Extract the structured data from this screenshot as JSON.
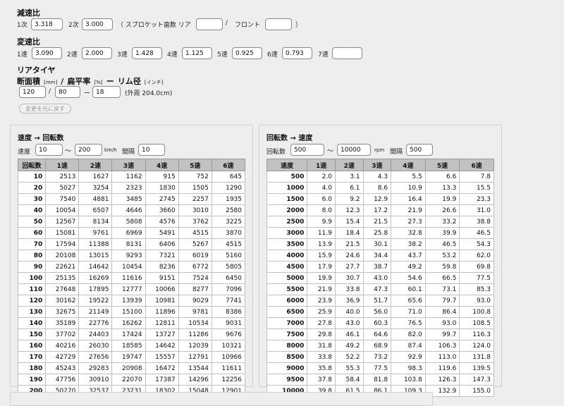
{
  "reduction": {
    "title": "減速比",
    "primary_label": "1次",
    "primary_value": "3.318",
    "secondary_label": "2次",
    "secondary_value": "3.000",
    "sprocket_label": "（ スプロケット歯数  リア",
    "rear_value": "",
    "slash": "/",
    "front_label": "フロント",
    "front_value": "",
    "close_paren": "）"
  },
  "gears": {
    "title": "変速比",
    "items": [
      {
        "label": "1速",
        "value": "3.090"
      },
      {
        "label": "2速",
        "value": "2.000"
      },
      {
        "label": "3速",
        "value": "1.428"
      },
      {
        "label": "4速",
        "value": "1.125"
      },
      {
        "label": "5速",
        "value": "0.925"
      },
      {
        "label": "6速",
        "value": "0.793"
      },
      {
        "label": "7速",
        "value": ""
      }
    ]
  },
  "tire": {
    "title": "リアタイヤ",
    "width_label": "断面積",
    "mm_unit": "[mm]",
    "slash1": "/",
    "aspect_label": "扁平率",
    "pct_unit": "[%]",
    "dash": "ー",
    "rim_label": "リム径",
    "inch_unit": "[インチ]",
    "width_value": "120",
    "aspect_value": "80",
    "rim_value": "18",
    "slash2": "/",
    "dash2": "ー",
    "circumference": "(外周 204.0cm)"
  },
  "reset_button": "変更を元に戻す",
  "speed_panel": {
    "title": "速度 → 回転数",
    "speed_label": "速度",
    "from": "10",
    "tilde": "〜",
    "to": "200",
    "unit": "km/h",
    "interval_label": "間隔",
    "interval": "10",
    "headers": [
      "回転数",
      "1速",
      "2速",
      "3速",
      "4速",
      "5速",
      "6速"
    ],
    "rows": [
      [
        "10",
        "2513",
        "1627",
        "1162",
        "915",
        "752",
        "645"
      ],
      [
        "20",
        "5027",
        "3254",
        "2323",
        "1830",
        "1505",
        "1290"
      ],
      [
        "30",
        "7540",
        "4881",
        "3485",
        "2745",
        "2257",
        "1935"
      ],
      [
        "40",
        "10054",
        "6507",
        "4646",
        "3660",
        "3010",
        "2580"
      ],
      [
        "50",
        "12567",
        "8134",
        "5808",
        "4576",
        "3762",
        "3225"
      ],
      [
        "60",
        "15081",
        "9761",
        "6969",
        "5491",
        "4515",
        "3870"
      ],
      [
        "70",
        "17594",
        "11388",
        "8131",
        "6406",
        "5267",
        "4515"
      ],
      [
        "80",
        "20108",
        "13015",
        "9293",
        "7321",
        "6019",
        "5160"
      ],
      [
        "90",
        "22621",
        "14642",
        "10454",
        "8236",
        "6772",
        "5805"
      ],
      [
        "100",
        "25135",
        "16269",
        "11616",
        "9151",
        "7524",
        "6450"
      ],
      [
        "110",
        "27648",
        "17895",
        "12777",
        "10066",
        "8277",
        "7096"
      ],
      [
        "120",
        "30162",
        "19522",
        "13939",
        "10981",
        "9029",
        "7741"
      ],
      [
        "130",
        "32675",
        "21149",
        "15100",
        "11896",
        "9781",
        "8386"
      ],
      [
        "140",
        "35189",
        "22776",
        "16262",
        "12811",
        "10534",
        "9031"
      ],
      [
        "150",
        "37702",
        "24403",
        "17424",
        "13727",
        "11286",
        "9676"
      ],
      [
        "160",
        "40216",
        "26030",
        "18585",
        "14642",
        "12039",
        "10321"
      ],
      [
        "170",
        "42729",
        "27656",
        "19747",
        "15557",
        "12791",
        "10966"
      ],
      [
        "180",
        "45243",
        "29283",
        "20908",
        "16472",
        "13544",
        "11611"
      ],
      [
        "190",
        "47756",
        "30910",
        "22070",
        "17387",
        "14296",
        "12256"
      ],
      [
        "200",
        "50270",
        "32537",
        "23231",
        "18302",
        "15048",
        "12901"
      ]
    ]
  },
  "rpm_panel": {
    "title": "回転数 → 速度",
    "rpm_label": "回転数",
    "from": "500",
    "tilde": "〜",
    "to": "10000",
    "unit": "rpm",
    "interval_label": "間隔",
    "interval": "500",
    "headers": [
      "速度",
      "1速",
      "2速",
      "3速",
      "4速",
      "5速",
      "6速"
    ],
    "rows": [
      [
        "500",
        "2.0",
        "3.1",
        "4.3",
        "5.5",
        "6.6",
        "7.8"
      ],
      [
        "1000",
        "4.0",
        "6.1",
        "8.6",
        "10.9",
        "13.3",
        "15.5"
      ],
      [
        "1500",
        "6.0",
        "9.2",
        "12.9",
        "16.4",
        "19.9",
        "23.3"
      ],
      [
        "2000",
        "8.0",
        "12.3",
        "17.2",
        "21.9",
        "26.6",
        "31.0"
      ],
      [
        "2500",
        "9.9",
        "15.4",
        "21.5",
        "27.3",
        "33.2",
        "38.8"
      ],
      [
        "3000",
        "11.9",
        "18.4",
        "25.8",
        "32.8",
        "39.9",
        "46.5"
      ],
      [
        "3500",
        "13.9",
        "21.5",
        "30.1",
        "38.2",
        "46.5",
        "54.3"
      ],
      [
        "4000",
        "15.9",
        "24.6",
        "34.4",
        "43.7",
        "53.2",
        "62.0"
      ],
      [
        "4500",
        "17.9",
        "27.7",
        "38.7",
        "49.2",
        "59.8",
        "69.8"
      ],
      [
        "5000",
        "19.9",
        "30.7",
        "43.0",
        "54.6",
        "66.5",
        "77.5"
      ],
      [
        "5500",
        "21.9",
        "33.8",
        "47.3",
        "60.1",
        "73.1",
        "85.3"
      ],
      [
        "6000",
        "23.9",
        "36.9",
        "51.7",
        "65.6",
        "79.7",
        "93.0"
      ],
      [
        "6500",
        "25.9",
        "40.0",
        "56.0",
        "71.0",
        "86.4",
        "100.8"
      ],
      [
        "7000",
        "27.8",
        "43.0",
        "60.3",
        "76.5",
        "93.0",
        "108.5"
      ],
      [
        "7500",
        "29.8",
        "46.1",
        "64.6",
        "82.0",
        "99.7",
        "116.3"
      ],
      [
        "8000",
        "31.8",
        "49.2",
        "68.9",
        "87.4",
        "106.3",
        "124.0"
      ],
      [
        "8500",
        "33.8",
        "52.2",
        "73.2",
        "92.9",
        "113.0",
        "131.8"
      ],
      [
        "9000",
        "35.8",
        "55.3",
        "77.5",
        "98.3",
        "119.6",
        "139.5"
      ],
      [
        "9500",
        "37.8",
        "58.4",
        "81.8",
        "103.8",
        "126.3",
        "147.3"
      ],
      [
        "10000",
        "39.8",
        "61.5",
        "86.1",
        "109.3",
        "132.9",
        "155.0"
      ]
    ]
  }
}
